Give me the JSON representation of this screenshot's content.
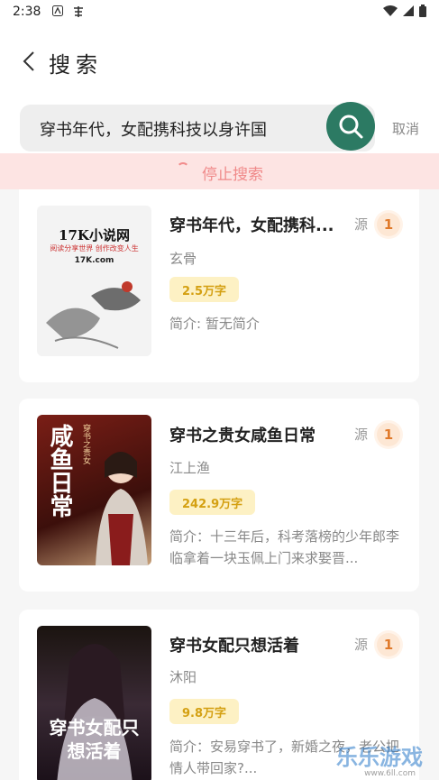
{
  "status": {
    "time": "2:38"
  },
  "header": {
    "title": "搜索"
  },
  "search": {
    "query": "穿书年代，女配携科技以身许国",
    "cancel": "取消"
  },
  "stop": {
    "label": "停止搜索"
  },
  "results": [
    {
      "title": "穿书年代，女配携科...",
      "source_label": "源",
      "source_count": "1",
      "author": "玄骨",
      "words": "2.5万字",
      "intro": "简介: 暂无简介",
      "cover_text": "17K小说网",
      "cover_sub": "阅读分享世界 创作改变人生",
      "cover_site": "17K.com"
    },
    {
      "title": "穿书之贵女咸鱼日常",
      "source_label": "源",
      "source_count": "1",
      "author": "江上渔",
      "words": "242.9万字",
      "intro": "简介：十三年后，科考落榜的少年郎李临拿着一块玉佩上门来求娶晋...",
      "cover_text": "咸鱼日常",
      "cover_sub": "穿书之贵女"
    },
    {
      "title": "穿书女配只想活着",
      "source_label": "源",
      "source_count": "1",
      "author": "沐阳",
      "words": "9.8万字",
      "intro": "简介：安易穿书了，新婚之夜，老公把情人带回家?...",
      "cover_text": "穿书女配只想活着"
    }
  ],
  "watermark": {
    "brand": "乐乐游戏",
    "url": "www.6ll.com"
  },
  "colors": {
    "accent": "#2c7a63",
    "stop_bg": "#fde4e3",
    "stop_text": "#f08a8a",
    "words_bg": "#fdf1c4",
    "words_text": "#d4a012"
  }
}
